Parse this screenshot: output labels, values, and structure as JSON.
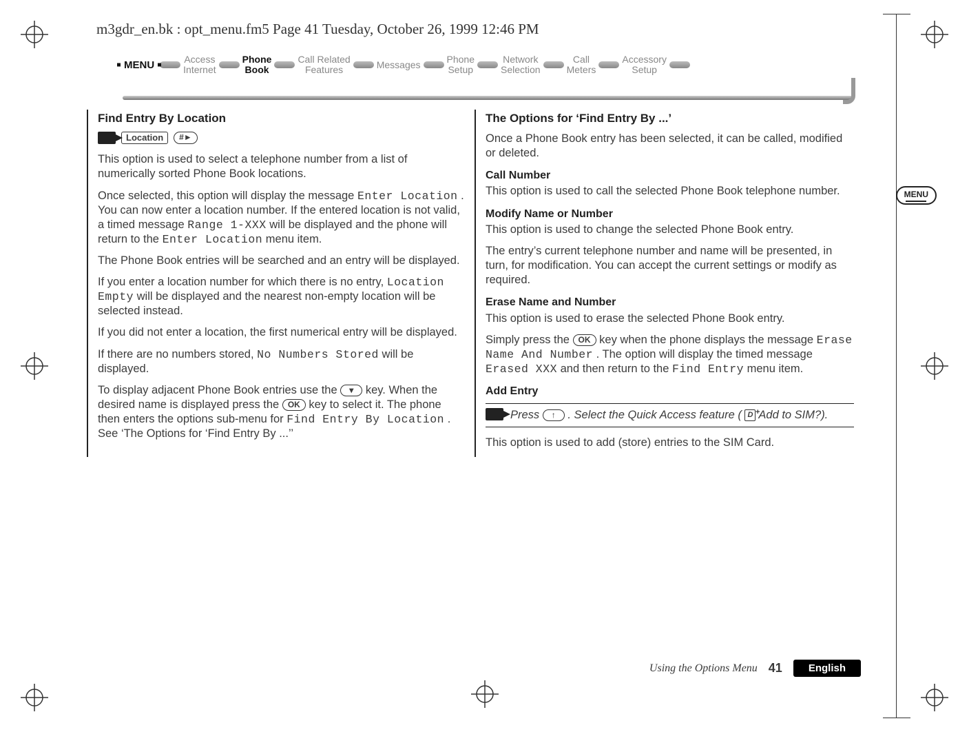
{
  "running_head": "m3gdr_en.bk : opt_menu.fm5  Page 41  Tuesday, October 26, 1999  12:46 PM",
  "ribbon": {
    "menu_label": "MENU",
    "items": [
      {
        "line1": "Access",
        "line2": "Internet"
      },
      {
        "line1": "Phone",
        "line2": "Book",
        "active": true
      },
      {
        "line1": "Call Related",
        "line2": "Features"
      },
      {
        "line1": "Messages",
        "line2": ""
      },
      {
        "line1": "Phone",
        "line2": "Setup"
      },
      {
        "line1": "Network",
        "line2": "Selection"
      },
      {
        "line1": "Call",
        "line2": "Meters"
      },
      {
        "line1": "Accessory",
        "line2": "Setup"
      }
    ]
  },
  "aside_menu_label": "MENU",
  "left": {
    "title": "Find Entry By Location",
    "shortcut_label": "Location",
    "shortcut_key": "#►",
    "p1": "This option is used to select a telephone number from a list of numerically sorted Phone Book locations.",
    "p2a": "Once selected, this option will display the message ",
    "p2_lcd1": "Enter Location",
    "p2b": ". You can now enter a location number. If the entered location is not valid, a timed message ",
    "p2_lcd2": "Range 1-XXX",
    "p2c": " will be displayed and the phone will return to the ",
    "p2_lcd3": "Enter Location",
    "p2d": " menu item.",
    "p3": "The Phone Book entries will be searched and an entry will be displayed.",
    "p4a": "If you enter a location number for which there is no entry, ",
    "p4_lcd": "Location Empty",
    "p4b": " will be displayed and the nearest non-empty location will be selected instead.",
    "p5": "If you did not enter a location, the first numerical entry will be displayed.",
    "p6a": "If there are no numbers stored, ",
    "p6_lcd": "No Numbers Stored",
    "p6b": " will be displayed.",
    "p7a": "To display adjacent Phone Book entries use the ",
    "key_down": "▾",
    "p7b": " key. When the desired name is displayed press the ",
    "key_ok": "OK",
    "p7c": " key to select it. The phone then enters the options sub-menu for ",
    "p7_lcd": "Find Entry By Location",
    "p7d": ". See ‘The Options for ‘Find Entry By ...’’"
  },
  "right": {
    "title": "The Options for ‘Find Entry By ...’",
    "p1": "Once a Phone Book entry has been selected, it can be called, modified or deleted.",
    "sub1": "Call Number",
    "sub1_p": "This option is used to call the selected Phone Book telephone number.",
    "sub2": "Modify Name or Number",
    "sub2_p1": "This option is used to change the selected Phone Book entry.",
    "sub2_p2": "The entry’s current telephone number and name will be presented, in turn, for modification. You can accept the current settings or modify as required.",
    "sub3": "Erase Name and Number",
    "sub3_p1": "This option is used to erase the selected Phone Book entry.",
    "sub3_p2a": "Simply press the ",
    "key_ok": "OK",
    "sub3_p2b": " key when the phone displays the message ",
    "sub3_lcd1": "Erase Name And Number",
    "sub3_p2c": ". The option will display the timed message ",
    "sub3_lcd2": "Erased XXX",
    "sub3_p2d": " and then return to the ",
    "sub3_lcd3": "Find Entry",
    "sub3_p2e": " menu item.",
    "sub4": "Add Entry",
    "tip_a": "Press ",
    "key_up": "↑",
    "tip_b": ". Select the Quick Access feature (",
    "qa_icon_label": "D",
    "tip_c": " Add to SIM?).",
    "sub4_p": "This option is used to add (store) entries to the SIM Card."
  },
  "footer": {
    "section": "Using the Options Menu",
    "page": "41",
    "language": "English"
  }
}
